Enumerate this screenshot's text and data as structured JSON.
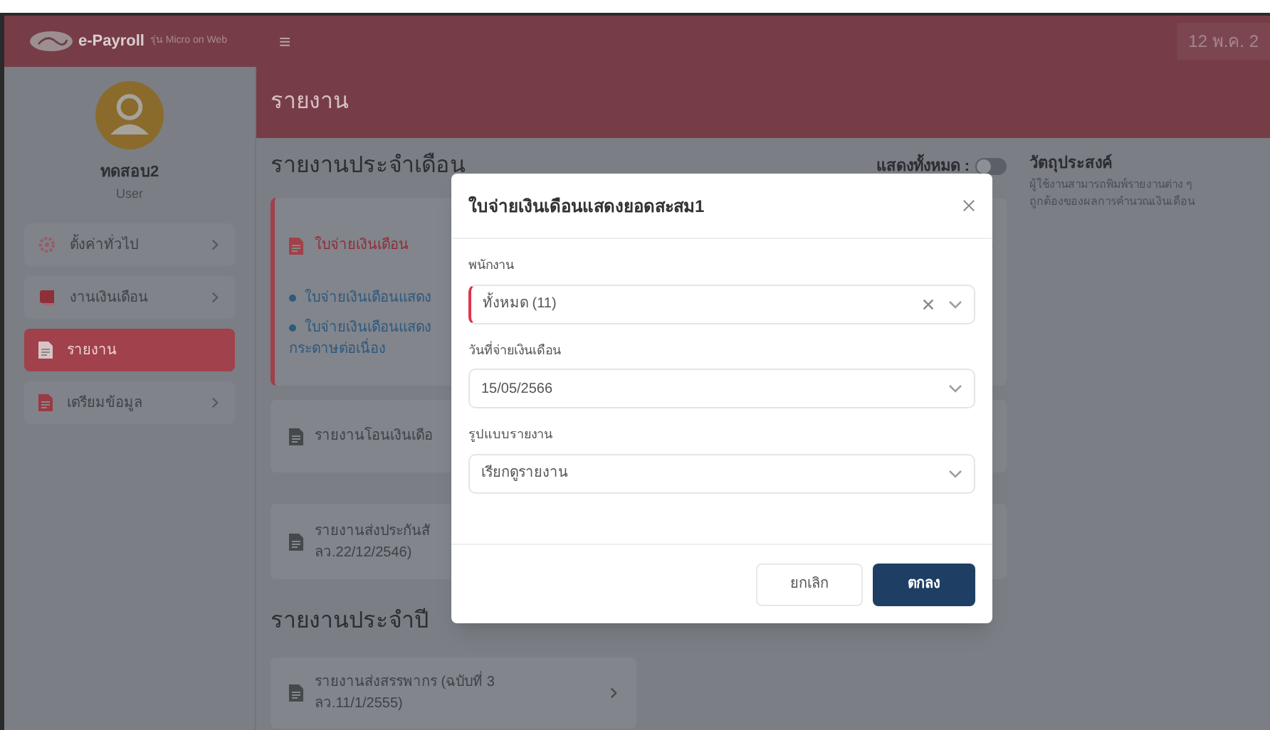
{
  "header": {
    "logo_text": "e-Payroll",
    "logo_subtitle": "รุ่น Micro on Web",
    "menu_glyph": "≡",
    "date": "12 พ.ค. 2"
  },
  "sidebar": {
    "user_name": "ทดสอบ2",
    "user_role": "User",
    "items": [
      {
        "label": "ตั้งค่าทั่วไป",
        "kind": "gear",
        "selected": false,
        "has_submenu": true
      },
      {
        "label": "งานเงินเดือน",
        "kind": "book",
        "selected": false,
        "has_submenu": true
      },
      {
        "label": "รายงาน",
        "kind": "document",
        "selected": true,
        "has_submenu": false
      },
      {
        "label": "เตรียมข้อมูล",
        "kind": "document",
        "selected": false,
        "has_submenu": true
      }
    ]
  },
  "page_title": "รายงาน",
  "monthly": {
    "heading": "รายงานประจำเดือน",
    "toggle_label": "แสดงทั้งหมด :",
    "toggle_on": false,
    "cards": [
      {
        "title": "ใบจ่ายเงินเดือน",
        "expanded": true,
        "links": [
          [
            "ใบจ่ายเงินเดือนแสดง"
          ],
          [
            "ใบจ่ายเงินเดือนแสดง",
            "กระดาษต่อเนื่อง"
          ]
        ]
      },
      {
        "title": "รายงานโอนเงินเดือ",
        "expanded": false
      },
      {
        "title": "รายงานส่งประกันสั",
        "subtitle": "ลว.22/12/2546)",
        "expanded": false
      }
    ]
  },
  "annual": {
    "heading": "รายงานประจำปี",
    "cards": [
      {
        "title": "รายงานส่งสรรพากร (ฉบับที่ 3",
        "subtitle": "ลว.11/1/2555)"
      }
    ]
  },
  "purpose": {
    "heading": "วัตถุประสงค์",
    "lines": [
      "ผู้ใช้งานสามารถพิมพ์รายงานต่าง ๆ",
      "ถูกต้องของผลการคำนวณเงินเดือน"
    ]
  },
  "dialog": {
    "title": "ใบจ่ายเงินเดือนแสดงยอดสะสม1",
    "fields": [
      {
        "label": "พนักงาน",
        "value": "ทั้งหมด (11)",
        "clearable": true,
        "required": true
      },
      {
        "label": "วันที่จ่ายเงินเดือน",
        "value": "15/05/2566",
        "clearable": false,
        "required": false
      },
      {
        "label": "รูปแบบรายงาน",
        "value": "เรียกดูรายงาน",
        "clearable": false,
        "required": false
      }
    ],
    "buttons": [
      {
        "label": "ยกเลิก",
        "kind": "secondary"
      },
      {
        "label": "ตกลง",
        "kind": "primary"
      }
    ]
  }
}
